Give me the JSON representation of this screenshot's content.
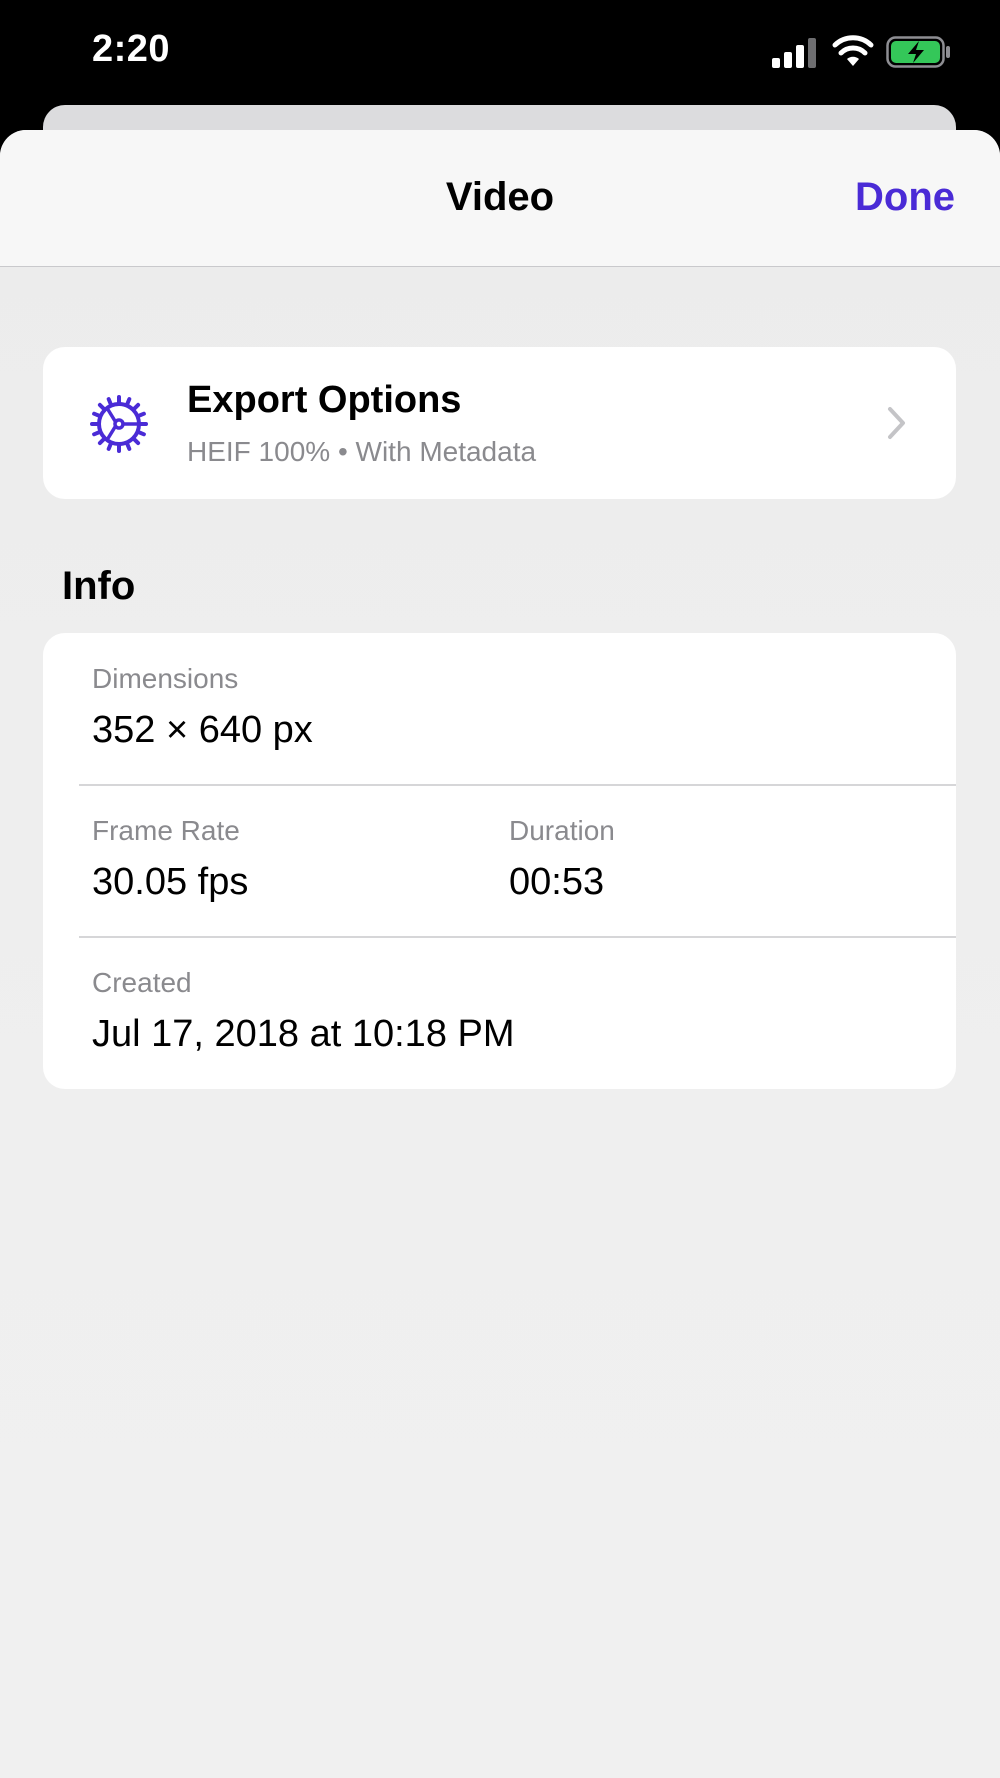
{
  "status_bar": {
    "time": "2:20",
    "battery_color": "#34c759"
  },
  "navbar": {
    "title": "Video",
    "done_label": "Done",
    "accent_color": "#4a2bd6"
  },
  "export_options": {
    "icon": "gear-icon",
    "title": "Export Options",
    "subtitle": "HEIF 100% • With Metadata"
  },
  "info": {
    "header": "Info",
    "dimensions_label": "Dimensions",
    "dimensions_value": "352 × 640 px",
    "frame_rate_label": "Frame Rate",
    "frame_rate_value": "30.05 fps",
    "duration_label": "Duration",
    "duration_value": "00:53",
    "created_label": "Created",
    "created_value": "Jul 17, 2018 at 10:18 PM"
  }
}
